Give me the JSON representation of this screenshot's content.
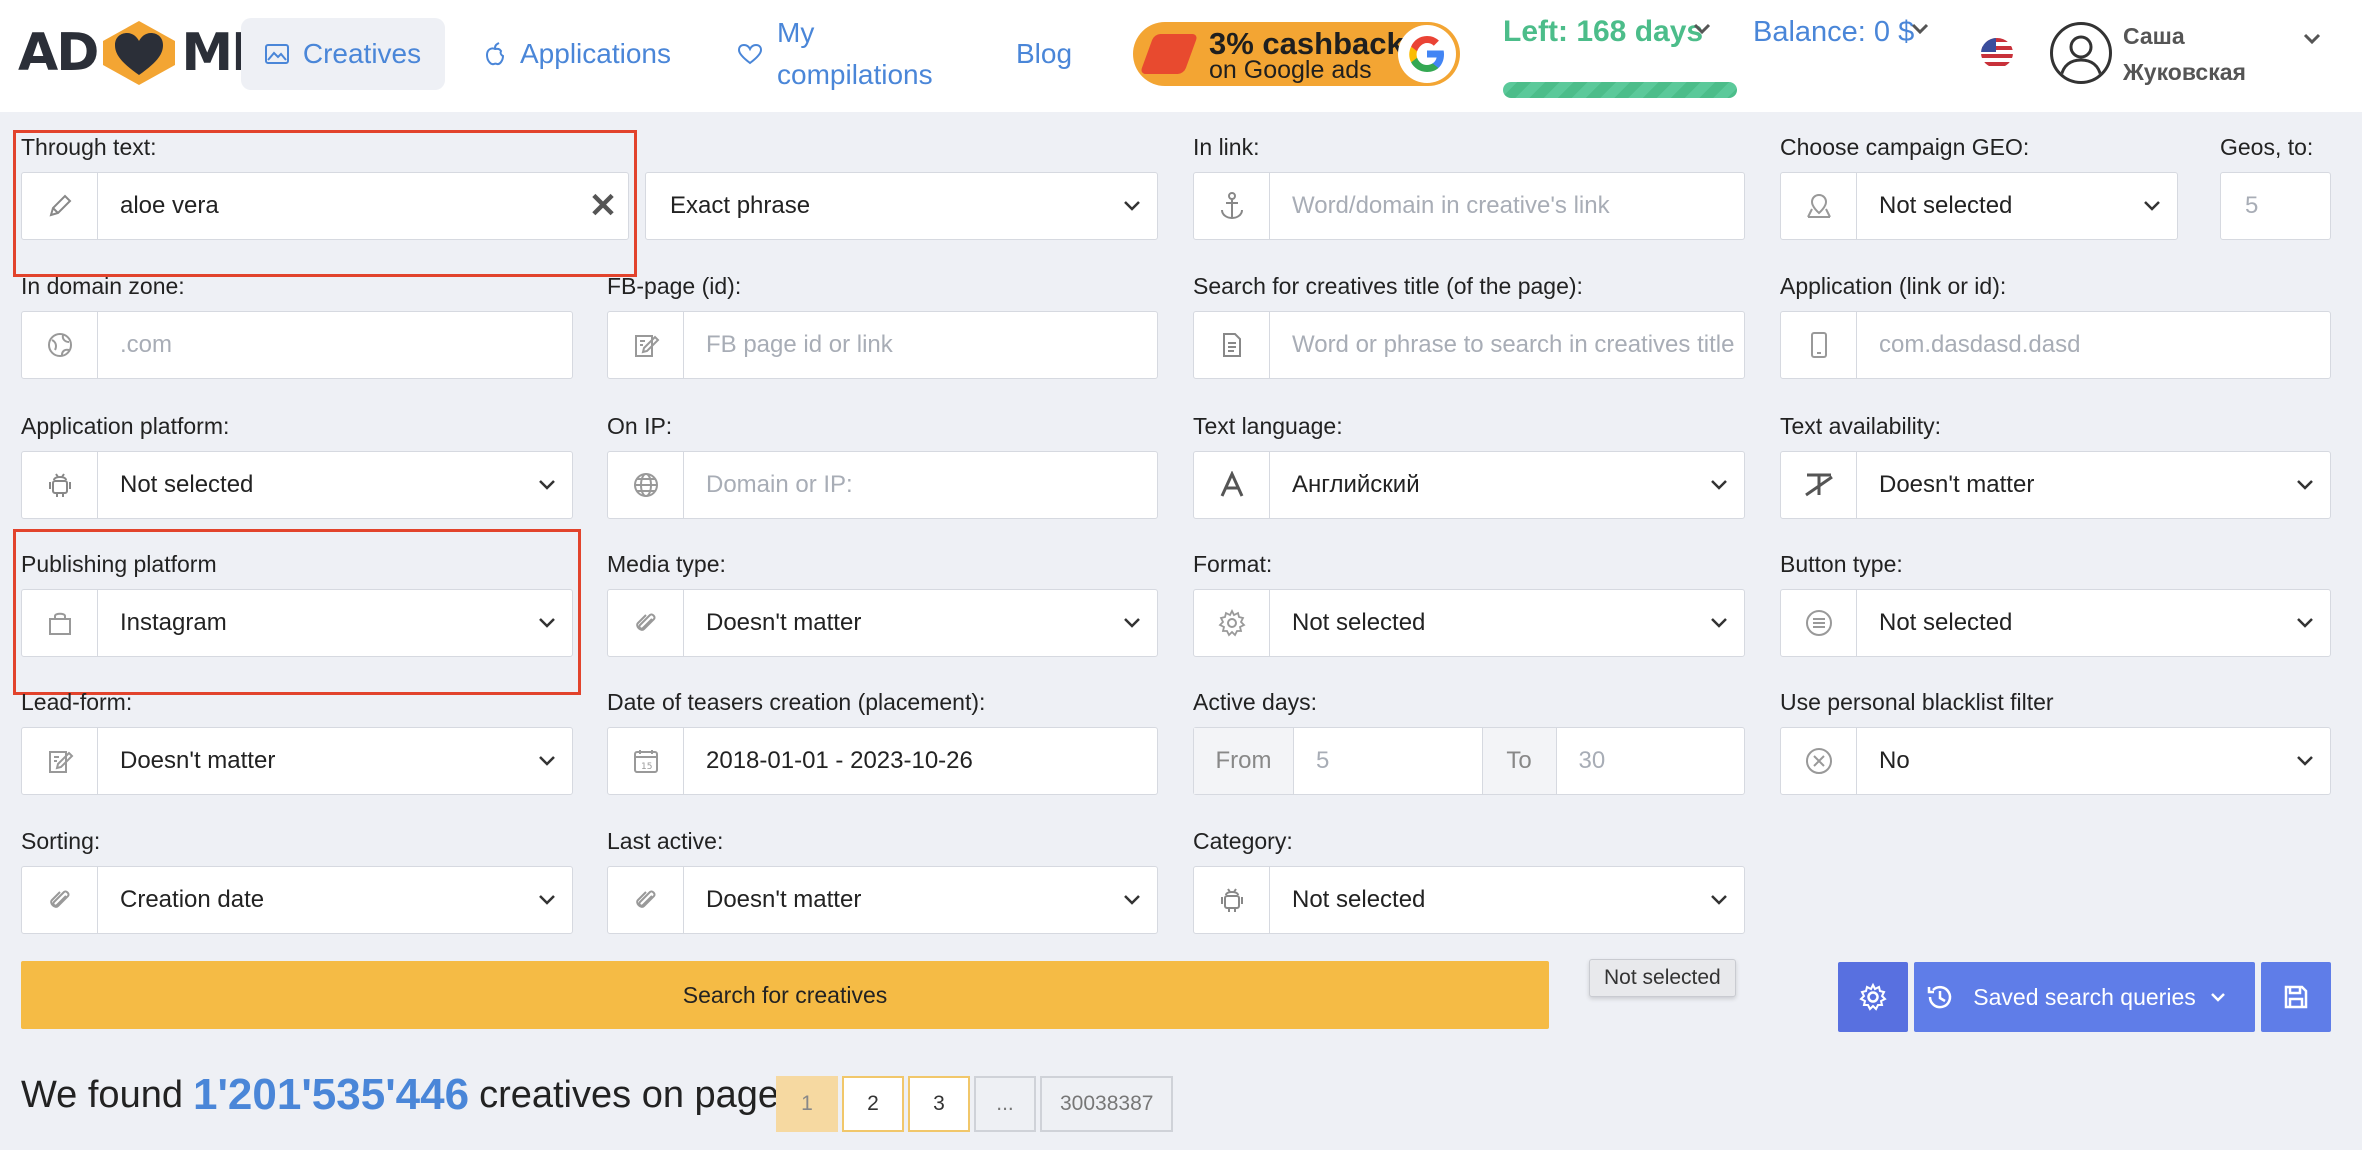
{
  "header": {
    "logo_left": "AD",
    "logo_right": "ME",
    "nav": {
      "creatives": "Creatives",
      "applications": "Applications",
      "compilations": "My compilations",
      "blog": "Blog"
    },
    "promo": {
      "line1": "3% cashback",
      "line2": "on Google ads"
    },
    "left_days": "Left: 168 days",
    "balance": "Balance: 0 $",
    "user_name": "Саша Жуковская"
  },
  "form": {
    "through_text": {
      "label": "Through text:",
      "value": "aloe vera",
      "clear": "✕"
    },
    "match_mode": {
      "value": "Exact phrase"
    },
    "in_link": {
      "label": "In link:",
      "placeholder": "Word/domain in creative's link"
    },
    "campaign_geo": {
      "label": "Choose campaign GEO:",
      "value": "Not selected"
    },
    "geos_to": {
      "label": "Geos, to:",
      "placeholder": "5"
    },
    "domain_zone": {
      "label": "In domain zone:",
      "placeholder": ".com"
    },
    "fb_page": {
      "label": "FB-page (id):",
      "placeholder": "FB page id or link"
    },
    "creative_title": {
      "label": "Search for creatives title (of the page):",
      "placeholder": "Word or phrase to search in creatives title"
    },
    "application": {
      "label": "Application (link or id):",
      "placeholder": "com.dasdasd.dasd"
    },
    "app_platform": {
      "label": "Application platform:",
      "value": "Not selected"
    },
    "on_ip": {
      "label": "On IP:",
      "placeholder": "Domain or IP:"
    },
    "text_language": {
      "label": "Text language:",
      "value": "Английский"
    },
    "text_availability": {
      "label": "Text availability:",
      "value": "Doesn't matter"
    },
    "publishing_platform": {
      "label": "Publishing platform",
      "value": "Instagram"
    },
    "media_type": {
      "label": "Media type:",
      "value": "Doesn't matter"
    },
    "format": {
      "label": "Format:",
      "value": "Not selected"
    },
    "button_type": {
      "label": "Button type:",
      "value": "Not selected"
    },
    "lead_form": {
      "label": "Lead-form:",
      "value": "Doesn't matter"
    },
    "date_creation": {
      "label": "Date of teasers creation (placement):",
      "value": "2018-01-01 - 2023-10-26"
    },
    "active_days": {
      "label": "Active days:",
      "from_label": "From",
      "from_placeholder": "5",
      "to_label": "To",
      "to_placeholder": "30"
    },
    "blacklist": {
      "label": "Use personal blacklist filter",
      "value": "No"
    },
    "sorting": {
      "label": "Sorting:",
      "value": "Creation date"
    },
    "last_active": {
      "label": "Last active:",
      "value": "Doesn't matter"
    },
    "category": {
      "label": "Category:",
      "value": "Not selected"
    }
  },
  "actions": {
    "search": "Search for creatives",
    "tooltip": "Not selected",
    "saved_queries": "Saved search queries"
  },
  "results": {
    "prefix": "We found",
    "count": "1'201'535'446",
    "suffix": "creatives on pages:",
    "pages": [
      "1",
      "2",
      "3",
      "...",
      "30038387"
    ]
  },
  "colors": {
    "accent": "#4a86d8",
    "search": "#f5bb45",
    "buttons": "#5f7de8",
    "highlight": "#e2432c",
    "days": "#4cbd8a"
  }
}
